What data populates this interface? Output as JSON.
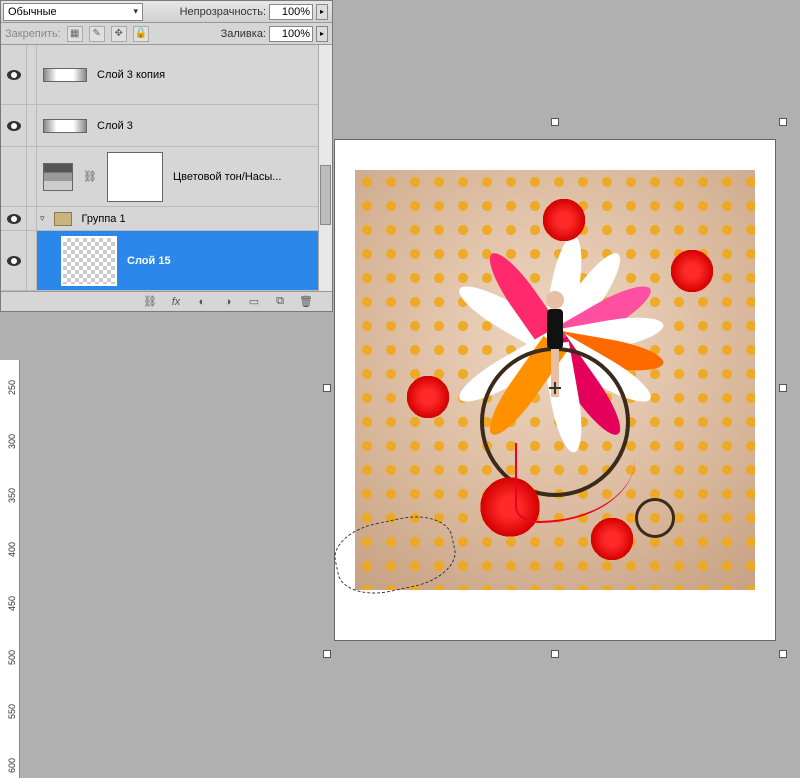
{
  "panel": {
    "blend_mode": "Обычные",
    "opacity_label": "Непрозрачность:",
    "opacity_value": "100%",
    "lock_label": "Закрепить:",
    "fill_label": "Заливка:",
    "fill_value": "100%"
  },
  "layers": {
    "l0": {
      "name": "Слой 3 копия"
    },
    "l1": {
      "name": "Слой 3"
    },
    "l2": {
      "name": "Цветовой тон/Насы..."
    },
    "group": {
      "name": "Группа 1"
    },
    "l3": {
      "name": "Слой 15"
    }
  },
  "ruler": {
    "t0": "250",
    "t1": "300",
    "t2": "350",
    "t3": "400",
    "t4": "450",
    "t5": "500",
    "t6": "550",
    "t7": "600"
  },
  "icons": {
    "lock_transparency": "▦",
    "lock_brush": "✎",
    "lock_move": "✥",
    "lock_all": "🔒",
    "link": "⛓",
    "fx": "fx",
    "mask": "◐",
    "adjust": "◑",
    "group_new": "▭",
    "new": "⧉",
    "trash": "🗑"
  }
}
